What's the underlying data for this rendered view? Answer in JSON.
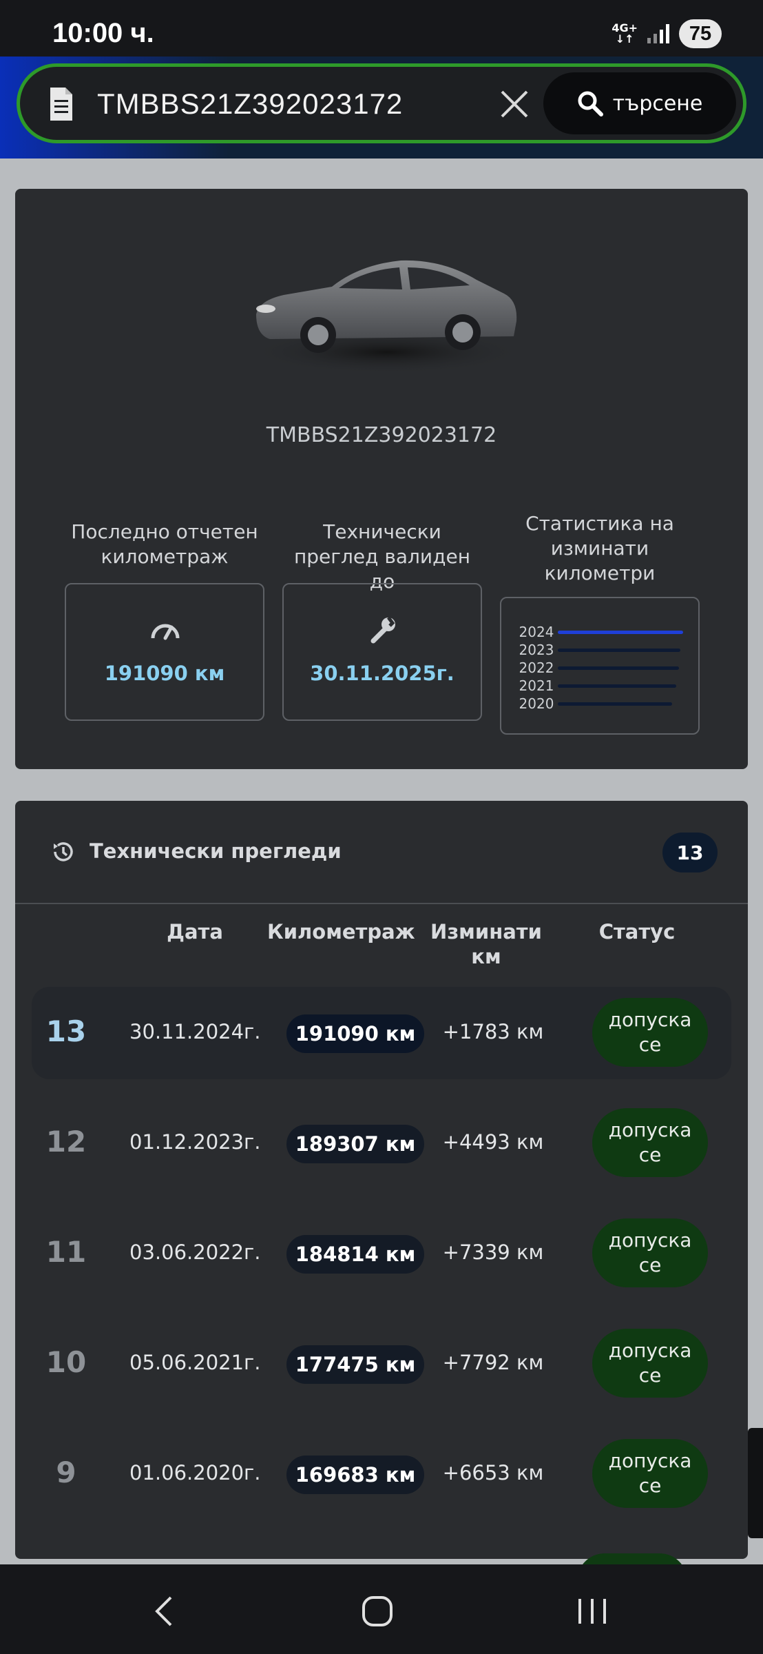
{
  "status_bar": {
    "time": "10:00 ч.",
    "network": "4G+",
    "battery": "75"
  },
  "search": {
    "value": "TMBBS21Z392023172",
    "button_label": "търсене",
    "icons": [
      "document-icon",
      "close-icon",
      "search-icon"
    ]
  },
  "vehicle": {
    "vin": "TMBBS21Z392023172",
    "mileage_label": "Последно отчетен километраж",
    "mileage_value": "191090 км",
    "inspection_label": "Технически преглед валиден до",
    "inspection_value": "30.11.2025г.",
    "stats_label": "Статистика на изминати километри",
    "icons": [
      "speedometer-icon",
      "wrench-icon",
      "car-image"
    ]
  },
  "chart_data": {
    "type": "bar",
    "categories": [
      "2024",
      "2023",
      "2022",
      "2021",
      "2020"
    ],
    "colors": [
      "#1f3fd8",
      "#0d1a33",
      "#0d1a33",
      "#0d1a33",
      "#0d1a33"
    ]
  },
  "inspections": {
    "title": "Технически прегледи",
    "count": "13",
    "columns": {
      "date": "Дата",
      "mileage": "Километраж",
      "driven": "Изминати км",
      "status": "Статус"
    },
    "rows": [
      {
        "num": "13",
        "date": "30.11.2024г.",
        "km": "191090 км",
        "diff": "+1783 км",
        "status": "допуска се"
      },
      {
        "num": "12",
        "date": "01.12.2023г.",
        "km": "189307 км",
        "diff": "+4493 км",
        "status": "допуска се"
      },
      {
        "num": "11",
        "date": "03.06.2022г.",
        "km": "184814 км",
        "diff": "+7339 км",
        "status": "допуска се"
      },
      {
        "num": "10",
        "date": "05.06.2021г.",
        "km": "177475 км",
        "diff": "+7792 км",
        "status": "допуска се"
      },
      {
        "num": "9",
        "date": "01.06.2020г.",
        "km": "169683 км",
        "diff": "+6653 км",
        "status": "допуска се"
      }
    ]
  },
  "colors": {
    "accent_border": "#2e9a2a",
    "status_green": "#0f3a12",
    "value_blue": "#8ad0f0"
  }
}
